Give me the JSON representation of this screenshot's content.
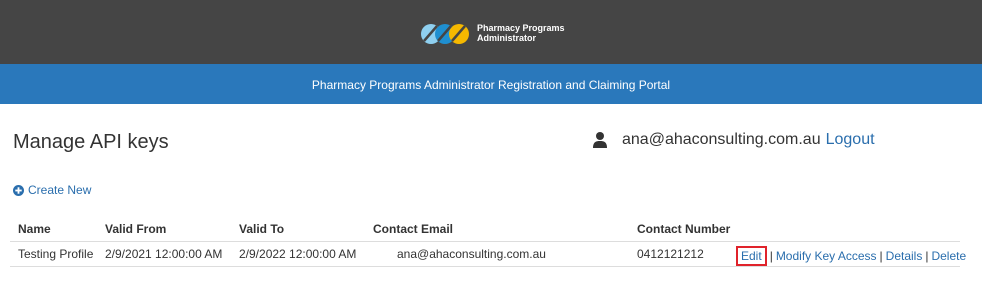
{
  "header": {
    "logo_line1": "Pharmacy Programs",
    "logo_line2": "Administrator",
    "portal_title": "Pharmacy Programs Administrator Registration and Claiming Portal"
  },
  "page": {
    "title": "Manage API keys"
  },
  "user": {
    "email": "ana@ahaconsulting.com.au",
    "logout_label": "Logout",
    "icon": "user-icon"
  },
  "actions": {
    "create_new_label": "Create New",
    "create_new_icon": "plus-circle-icon"
  },
  "table": {
    "columns": [
      "Name",
      "Valid From",
      "Valid To",
      "Contact Email",
      "Contact Number"
    ],
    "rows": [
      {
        "name": "Testing Profile",
        "valid_from": "2/9/2021 12:00:00 AM",
        "valid_to": "2/9/2022 12:00:00 AM",
        "contact_email": "ana@ahaconsulting.com.au",
        "contact_number": "0412121212",
        "links": {
          "edit": "Edit",
          "modify_key_access": "Modify Key Access",
          "details": "Details",
          "delete": "Delete",
          "separator": "|"
        }
      }
    ]
  },
  "colors": {
    "topbar": "#454545",
    "bluebar": "#2a78bb",
    "link": "#2a6ead",
    "highlight": "#e0232b"
  }
}
